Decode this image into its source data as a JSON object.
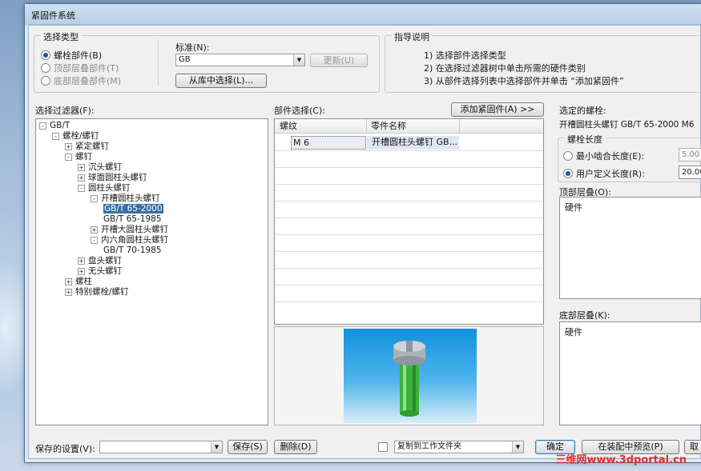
{
  "window": {
    "title": "紧固件系统"
  },
  "select_type": {
    "legend": "选择类型",
    "options": [
      {
        "label": "螺栓部件(B)",
        "checked": true,
        "enabled": true
      },
      {
        "label": "顶部层叠部件(T)",
        "checked": false,
        "enabled": false
      },
      {
        "label": "底部层叠部件(M)",
        "checked": false,
        "enabled": false
      }
    ],
    "standard_label": "标准(N):",
    "standard_value": "GB",
    "update_button": "更新(U)",
    "from_library_button": "从库中选择(L)..."
  },
  "guide": {
    "legend": "指导说明",
    "steps": [
      "1) 选择部件选择类型",
      "2) 在选择过滤器树中单击所需的硬件类别",
      "3) 从部件选择列表中选择部件并单击 “添加紧固件”"
    ]
  },
  "filter": {
    "label": "选择过滤器(F):",
    "tree": [
      {
        "text": "GB/T",
        "level": 0,
        "toggle": "-"
      },
      {
        "text": "螺栓/螺钉",
        "level": 1,
        "toggle": "-"
      },
      {
        "text": "紧定螺钉",
        "level": 2,
        "toggle": "+"
      },
      {
        "text": "螺钉",
        "level": 2,
        "toggle": "-"
      },
      {
        "text": "沉头螺钉",
        "level": 3,
        "toggle": "+"
      },
      {
        "text": "球面圆柱头螺钉",
        "level": 3,
        "toggle": "+"
      },
      {
        "text": "圆柱头螺钉",
        "level": 3,
        "toggle": "-"
      },
      {
        "text": "开槽圆柱头螺钉",
        "level": 4,
        "toggle": "-"
      },
      {
        "text": "GB/T 65-2000",
        "level": 5,
        "toggle": "",
        "selected": true
      },
      {
        "text": "GB/T 65-1985",
        "level": 5,
        "toggle": ""
      },
      {
        "text": "开槽大圆柱头螺钉",
        "level": 4,
        "toggle": "+"
      },
      {
        "text": "内六角圆柱头螺钉",
        "level": 4,
        "toggle": "-"
      },
      {
        "text": "GB/T 70-1985",
        "level": 5,
        "toggle": ""
      },
      {
        "text": "盘头螺钉",
        "level": 3,
        "toggle": "+"
      },
      {
        "text": "无头螺钉",
        "level": 3,
        "toggle": "+"
      },
      {
        "text": "螺柱",
        "level": 2,
        "toggle": "+"
      },
      {
        "text": "特别螺栓/螺钉",
        "level": 2,
        "toggle": "+"
      }
    ]
  },
  "parts": {
    "label": "部件选择(C):",
    "add_button": "添加紧固件(A) >>",
    "columns": [
      "螺纹",
      "零件名称"
    ],
    "rows": [
      {
        "thread": "M 6",
        "name": "开槽圆柱头螺钉 GB..."
      }
    ]
  },
  "selected_bolt": {
    "label": "选定的螺栓:",
    "value": "开槽圆柱头螺钉 GB/T 65-2000 M6",
    "length_legend": "螺栓长度",
    "min_length_label": "最小啮合长度(E):",
    "min_length_value": "5.00",
    "user_length_label": "用户定义长度(R):",
    "user_length_value": "20.00",
    "user_length_checked": true
  },
  "top_stack": {
    "label": "顶部层叠(O):",
    "item": "硬件"
  },
  "bottom_stack": {
    "label": "底部层叠(K):",
    "item": "硬件"
  },
  "footer": {
    "saved_settings_label": "保存的设置(V):",
    "saved_settings_value": "",
    "save_button": "保存(S)",
    "delete_button": "删除(D)",
    "copy_option": "复制到工作文件夹",
    "ok_button": "确定",
    "preview_button": "在装配中预览(P)",
    "cancel_button": "取"
  },
  "watermark": "三维网www.3dportal.cn"
}
